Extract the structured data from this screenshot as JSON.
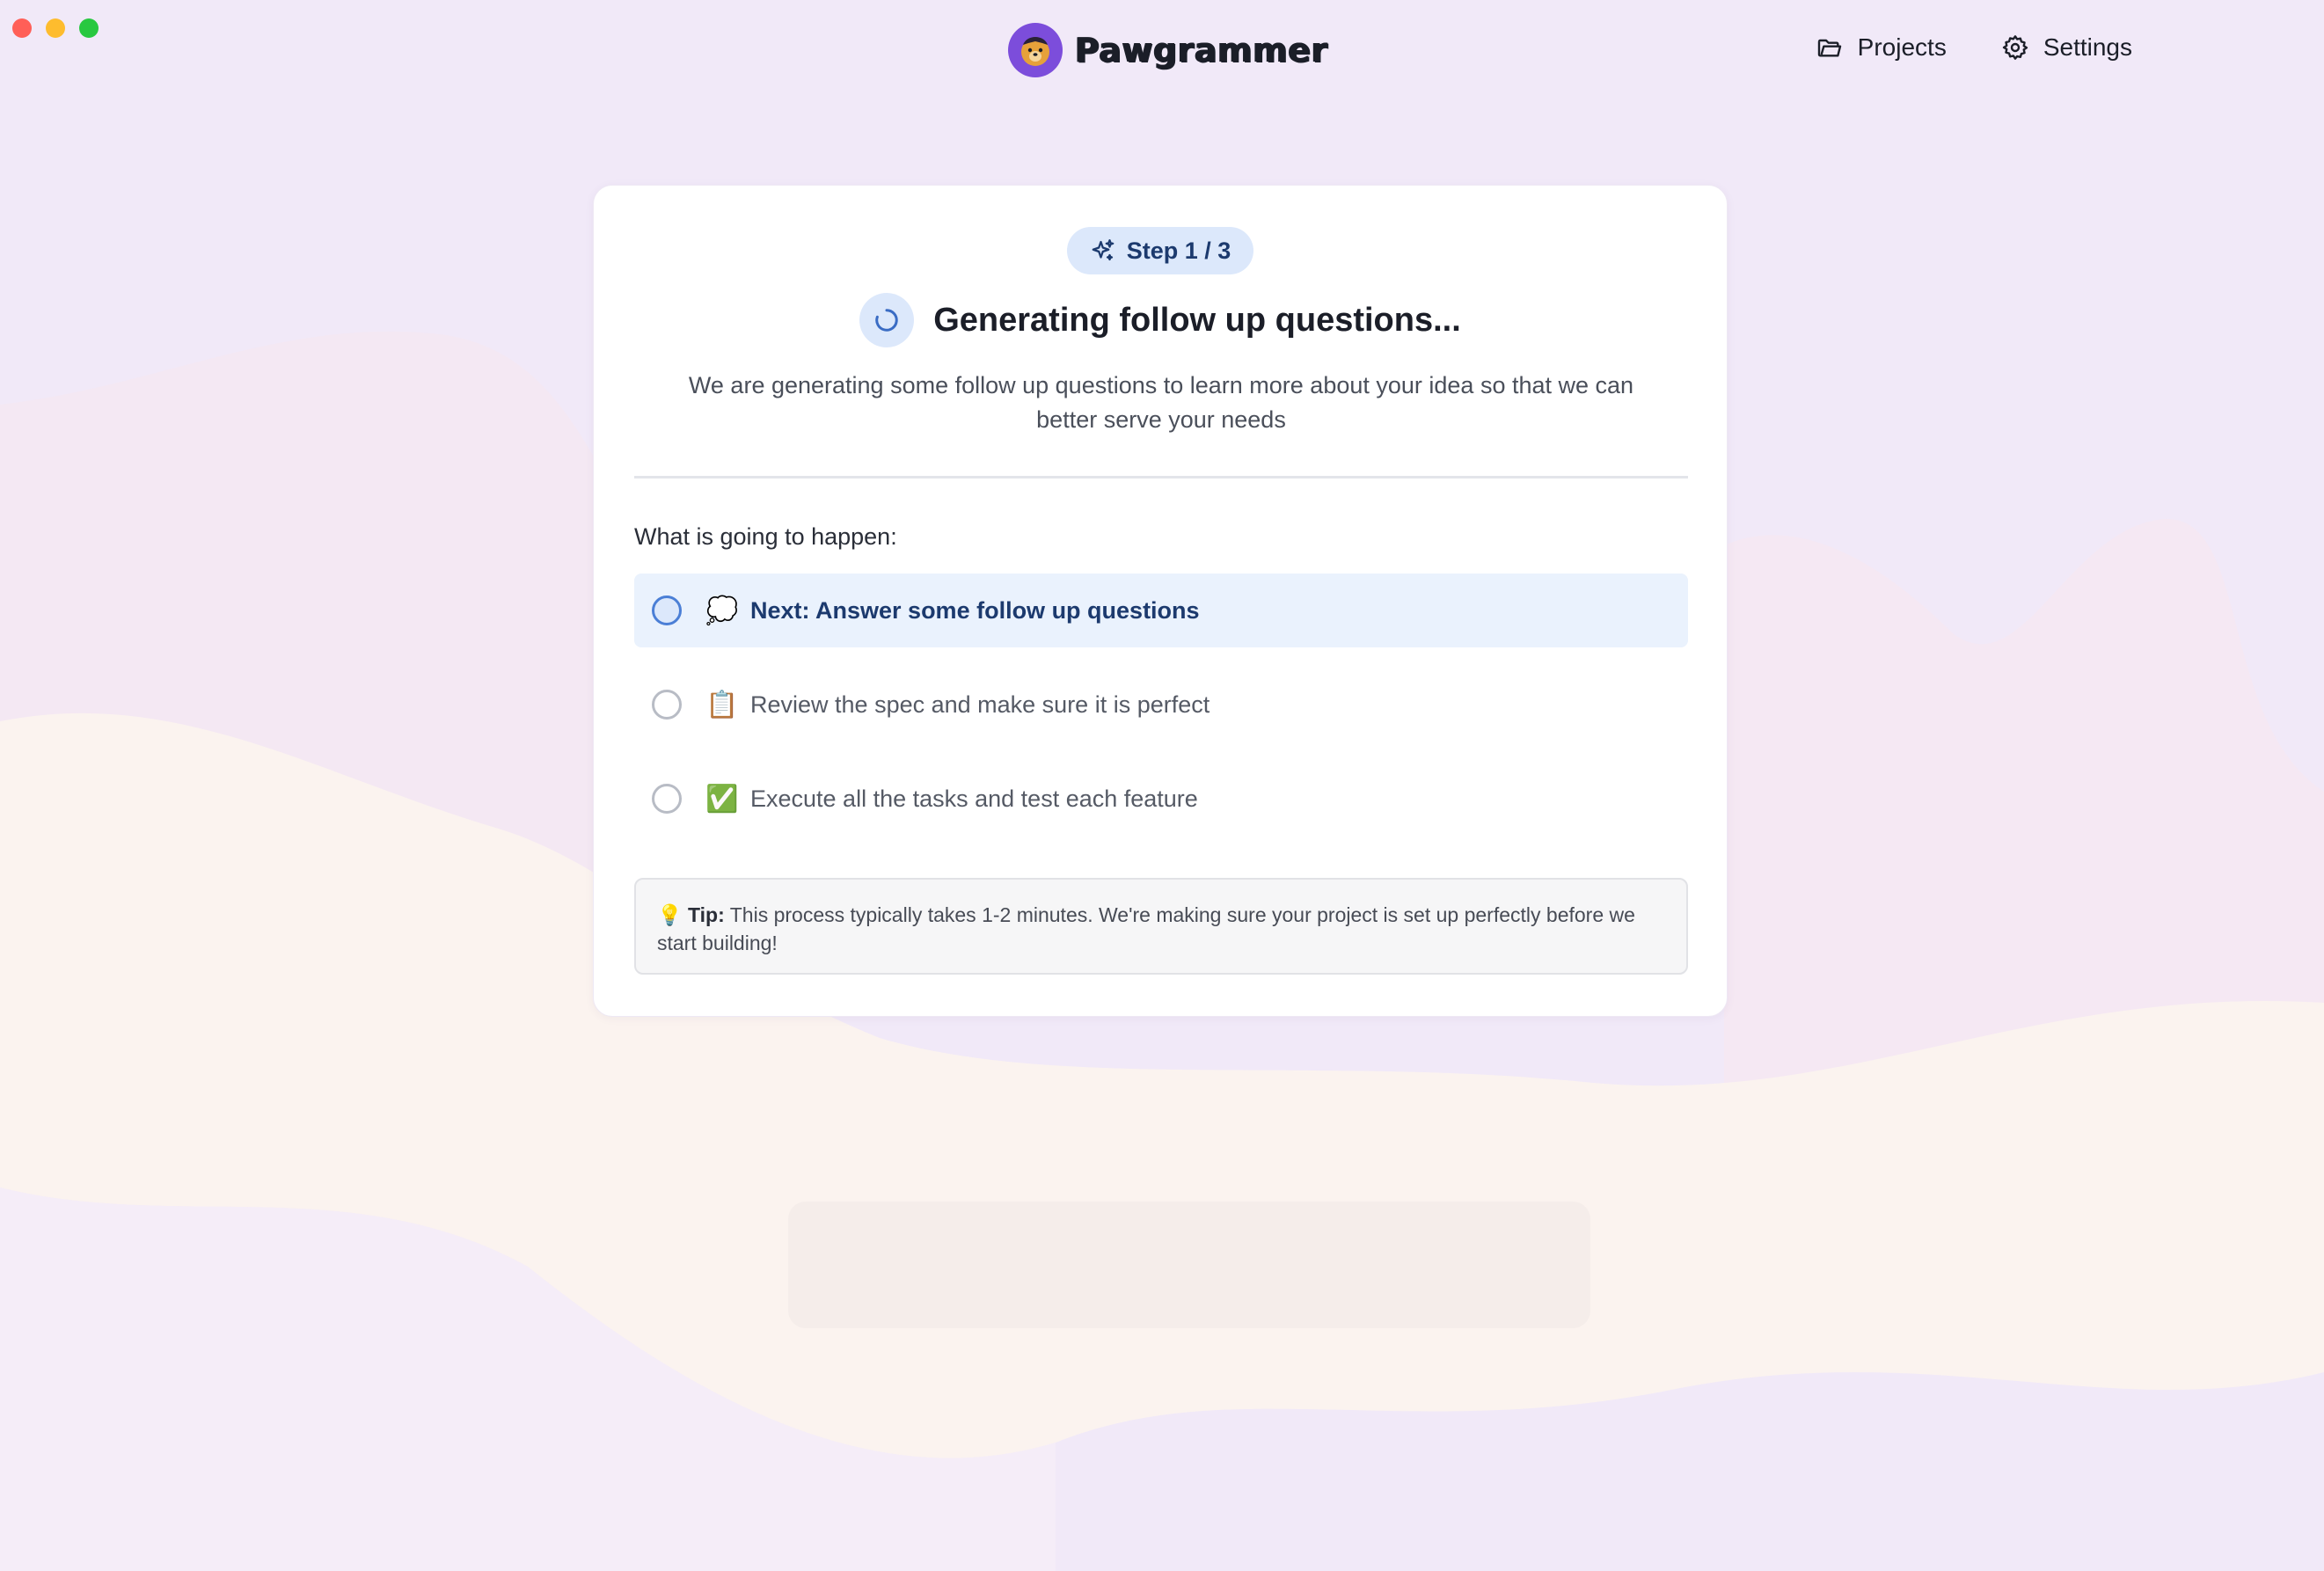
{
  "window": {
    "controls": [
      "close",
      "minimize",
      "maximize"
    ],
    "colors": {
      "close": "#ff5f57",
      "minimize": "#febc2e",
      "maximize": "#28c840"
    }
  },
  "header": {
    "brand_name": "Pawgrammer",
    "brand_icon": "paw-logo-icon",
    "nav": [
      {
        "label": "Projects",
        "icon": "folder-icon"
      },
      {
        "label": "Settings",
        "icon": "gear-icon"
      }
    ]
  },
  "card": {
    "step_label": "Step 1 / 3",
    "step_icon": "sparkles-icon",
    "title": "Generating follow up questions...",
    "title_icon": "spinner-icon",
    "subtitle": "We are generating some follow up questions to learn more about your idea so that we can better serve your needs",
    "section_label": "What is going to happen:",
    "steps": [
      {
        "emoji": "💭",
        "label": "Next: Answer some follow up questions",
        "active": true
      },
      {
        "emoji": "📋",
        "label": "Review the spec and make sure it is perfect",
        "active": false
      },
      {
        "emoji": "✅",
        "label": "Execute all the tasks and test each feature",
        "active": false
      }
    ],
    "tip": {
      "emoji": "💡",
      "label": "Tip:",
      "text": "This process typically takes 1-2 minutes. We're making sure your project is set up perfectly before we start building!"
    }
  },
  "colors": {
    "accent": "#4b7fd6",
    "accent_light": "#dce8fb",
    "background": "#f1e9f8",
    "brand_purple": "#7c4ddb"
  }
}
